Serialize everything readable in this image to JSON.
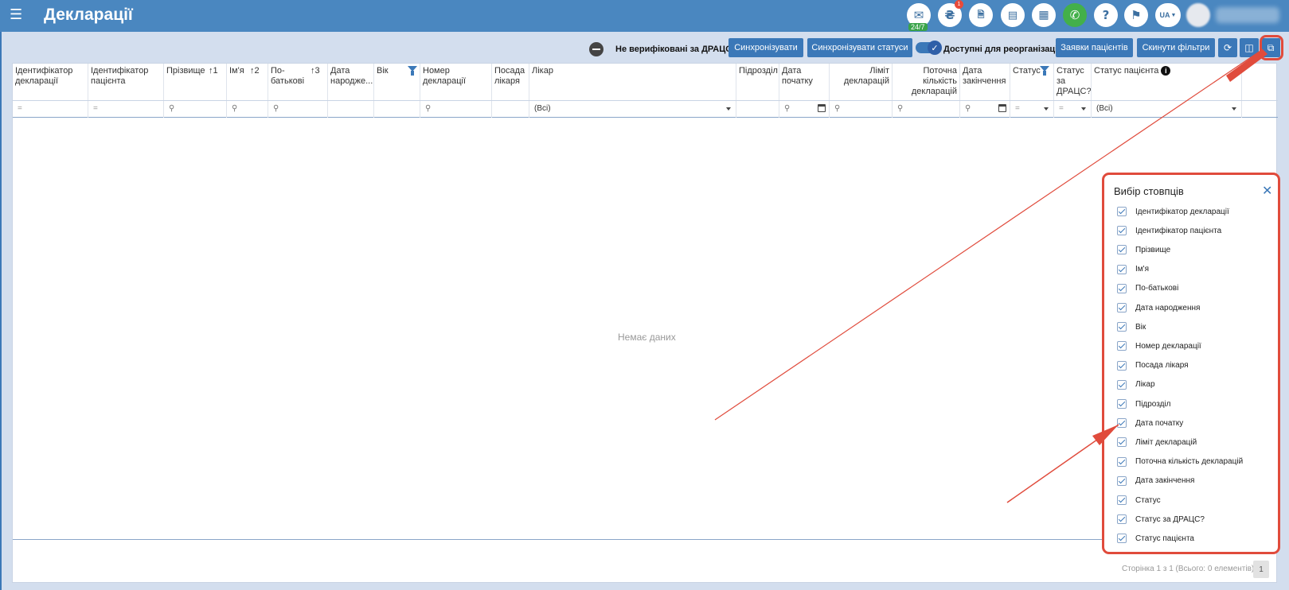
{
  "header": {
    "menu_icon": "hamburger-icon",
    "title": "Декларації",
    "chat_badge": "24/7",
    "notif_badge": "1",
    "lang": "UA",
    "icons": [
      "chat-icon",
      "coin-icon",
      "pdf-icon",
      "card-icon",
      "calculator-icon",
      "phone-icon",
      "help-icon",
      "megaphone-icon"
    ]
  },
  "toolbar": {
    "not_verified_label": "Не верифіковані за ДРАЦС",
    "sync_button": "Синхронізувати",
    "sync_status_button": "Синхронізувати статуси",
    "available_reorg_label": "Доступні для реорганізації",
    "patient_requests_button": "Заявки пацієнтів",
    "reset_filters_button": "Скинути фільтри"
  },
  "columns": [
    {
      "label": "Ідентифікатор декларації"
    },
    {
      "label": "Ідентифікатор пацієнта"
    },
    {
      "label": "Прізвище",
      "sort": "1"
    },
    {
      "label": "Ім'я",
      "sort": "2"
    },
    {
      "label": "По-батькові",
      "sort": "3"
    },
    {
      "label": "Дата народже..."
    },
    {
      "label": "Вік"
    },
    {
      "label": "Номер декларації"
    },
    {
      "label": "Посада лікаря"
    },
    {
      "label": "Лікар"
    },
    {
      "label": "Підрозділ"
    },
    {
      "label": "Дата початку"
    },
    {
      "label": "Ліміт декларацій"
    },
    {
      "label": "Поточна кількість декларацій"
    },
    {
      "label": "Дата закінчення"
    },
    {
      "label": "Статус"
    },
    {
      "label": "Статус за ДРАЦС?"
    },
    {
      "label": "Статус пацієнта"
    }
  ],
  "filters": {
    "equals": "=",
    "all": "(Всі)"
  },
  "grid": {
    "no_data": "Немає даних",
    "pager_text": "Сторінка 1 з 1 (Всього: 0 елементів)",
    "page": "1"
  },
  "chooser": {
    "title": "Вибір стовпців",
    "items": [
      "Ідентифікатор декларації",
      "Ідентифікатор пацієнта",
      "Прізвище",
      "Ім'я",
      "По-батькові",
      "Дата народження",
      "Вік",
      "Номер декларації",
      "Посада лікаря",
      "Лікар",
      "Підрозділ",
      "Дата початку",
      "Ліміт декларацій",
      "Поточна кількість декларацій",
      "Дата закінчення",
      "Статус",
      "Статус за ДРАЦС?",
      "Статус пацієнта"
    ]
  },
  "colors": {
    "header": "#4a87c0",
    "accent": "#3b78b8",
    "highlight": "#e04b3c"
  }
}
